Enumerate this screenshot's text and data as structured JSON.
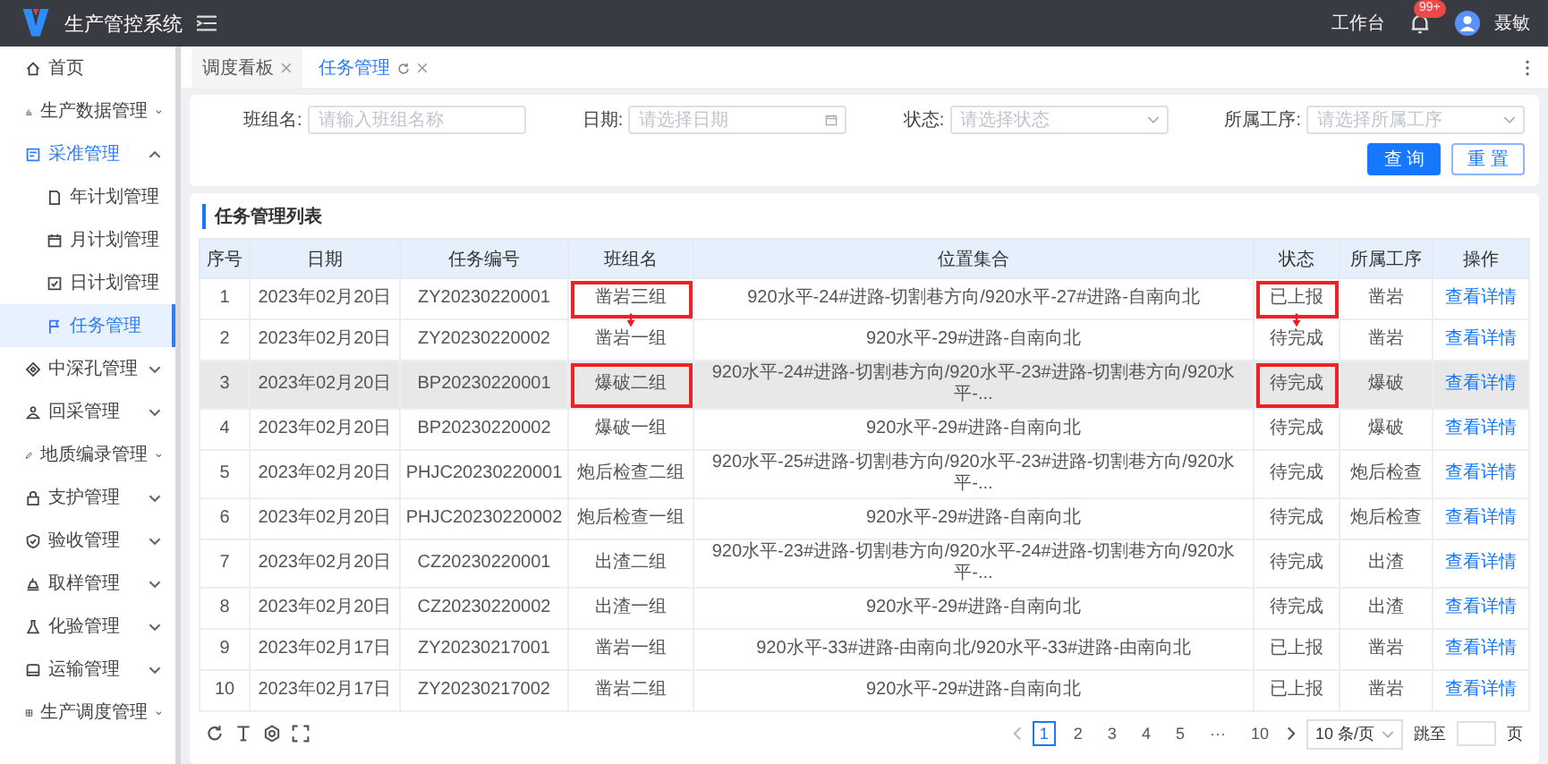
{
  "header": {
    "title": "生产管控系统",
    "workbench": "工作台",
    "badge": "99+",
    "user": "聂敏"
  },
  "sidebar": {
    "items": [
      {
        "label": "首页",
        "selected": false
      },
      {
        "label": "生产数据管理",
        "selected": false,
        "expanded": false
      },
      {
        "label": "采准管理",
        "selected": false,
        "expanded": true,
        "children": [
          {
            "label": "年计划管理",
            "selected": false
          },
          {
            "label": "月计划管理",
            "selected": false
          },
          {
            "label": "日计划管理",
            "selected": false
          },
          {
            "label": "任务管理",
            "selected": true
          }
        ]
      },
      {
        "label": "中深孔管理",
        "selected": false,
        "expanded": false
      },
      {
        "label": "回采管理",
        "selected": false,
        "expanded": false
      },
      {
        "label": "地质编录管理",
        "selected": false,
        "expanded": false
      },
      {
        "label": "支护管理",
        "selected": false,
        "expanded": false
      },
      {
        "label": "验收管理",
        "selected": false,
        "expanded": false
      },
      {
        "label": "取样管理",
        "selected": false,
        "expanded": false
      },
      {
        "label": "化验管理",
        "selected": false,
        "expanded": false
      },
      {
        "label": "运输管理",
        "selected": false,
        "expanded": false
      },
      {
        "label": "生产调度管理",
        "selected": false,
        "expanded": false
      }
    ]
  },
  "tabs": [
    {
      "label": "调度看板",
      "selected": false,
      "refresh": false
    },
    {
      "label": "任务管理",
      "selected": true,
      "refresh": true
    }
  ],
  "filters": [
    {
      "label": "班组名:",
      "placeholder": "请输入班组名称",
      "kind": "text"
    },
    {
      "label": "日期:",
      "placeholder": "请选择日期",
      "kind": "date"
    },
    {
      "label": "状态:",
      "placeholder": "请选择状态",
      "kind": "select"
    },
    {
      "label": "所属工序:",
      "placeholder": "请选择所属工序",
      "kind": "select"
    }
  ],
  "buttons": [
    {
      "label": "查 询",
      "kind": "primary"
    },
    {
      "label": "重 置",
      "kind": "default"
    }
  ],
  "table": {
    "title": "任务管理列表",
    "columns": [
      "序号",
      "日期",
      "任务编号",
      "班组名",
      "位置集合",
      "状态",
      "所属工序",
      "操作"
    ],
    "rows": [
      {
        "cells": [
          "1",
          "2023年02月20日",
          "ZY20230220001",
          "凿岩三组",
          "920水平-24#进路-切割巷方向/920水平-27#进路-自南向北",
          "已上报",
          "凿岩",
          "查看详情"
        ],
        "hovered": false,
        "marked": true,
        "arrow": true
      },
      {
        "cells": [
          "2",
          "2023年02月20日",
          "ZY20230220002",
          "凿岩一组",
          "920水平-29#进路-自南向北",
          "待完成",
          "凿岩",
          "查看详情"
        ],
        "hovered": false,
        "marked": false,
        "arrow": false
      },
      {
        "cells": [
          "3",
          "2023年02月20日",
          "BP20230220001",
          "爆破二组",
          "920水平-24#进路-切割巷方向/920水平-23#进路-切割巷方向/920水平-...",
          "待完成",
          "爆破",
          "查看详情"
        ],
        "hovered": true,
        "marked": true,
        "arrow": false
      },
      {
        "cells": [
          "4",
          "2023年02月20日",
          "BP20230220002",
          "爆破一组",
          "920水平-29#进路-自南向北",
          "待完成",
          "爆破",
          "查看详情"
        ],
        "hovered": false,
        "marked": false,
        "arrow": false
      },
      {
        "cells": [
          "5",
          "2023年02月20日",
          "PHJC20230220001",
          "炮后检查二组",
          "920水平-25#进路-切割巷方向/920水平-23#进路-切割巷方向/920水平-...",
          "待完成",
          "炮后检查",
          "查看详情"
        ],
        "hovered": false,
        "marked": false,
        "arrow": false
      },
      {
        "cells": [
          "6",
          "2023年02月20日",
          "PHJC20230220002",
          "炮后检查一组",
          "920水平-29#进路-自南向北",
          "待完成",
          "炮后检查",
          "查看详情"
        ],
        "hovered": false,
        "marked": false,
        "arrow": false
      },
      {
        "cells": [
          "7",
          "2023年02月20日",
          "CZ20230220001",
          "出渣二组",
          "920水平-23#进路-切割巷方向/920水平-24#进路-切割巷方向/920水平-...",
          "待完成",
          "出渣",
          "查看详情"
        ],
        "hovered": false,
        "marked": false,
        "arrow": false
      },
      {
        "cells": [
          "8",
          "2023年02月20日",
          "CZ20230220002",
          "出渣一组",
          "920水平-29#进路-自南向北",
          "待完成",
          "出渣",
          "查看详情"
        ],
        "hovered": false,
        "marked": false,
        "arrow": false
      },
      {
        "cells": [
          "9",
          "2023年02月17日",
          "ZY20230217001",
          "凿岩一组",
          "920水平-33#进路-由南向北/920水平-33#进路-由南向北",
          "已上报",
          "凿岩",
          "查看详情"
        ],
        "hovered": false,
        "marked": false,
        "arrow": false
      },
      {
        "cells": [
          "10",
          "2023年02月17日",
          "ZY20230217002",
          "凿岩二组",
          "920水平-29#进路-自南向北",
          "已上报",
          "凿岩",
          "查看详情"
        ],
        "hovered": false,
        "marked": false,
        "arrow": false
      }
    ]
  },
  "pagination": {
    "pages": [
      {
        "label": "1",
        "selected": true
      },
      {
        "label": "2",
        "selected": false
      },
      {
        "label": "3",
        "selected": false
      },
      {
        "label": "4",
        "selected": false
      },
      {
        "label": "5",
        "selected": false
      },
      {
        "label": "···",
        "selected": false
      },
      {
        "label": "10",
        "selected": false
      }
    ],
    "page_size": "10 条/页",
    "jump_label": "跳至",
    "page_unit": "页"
  }
}
